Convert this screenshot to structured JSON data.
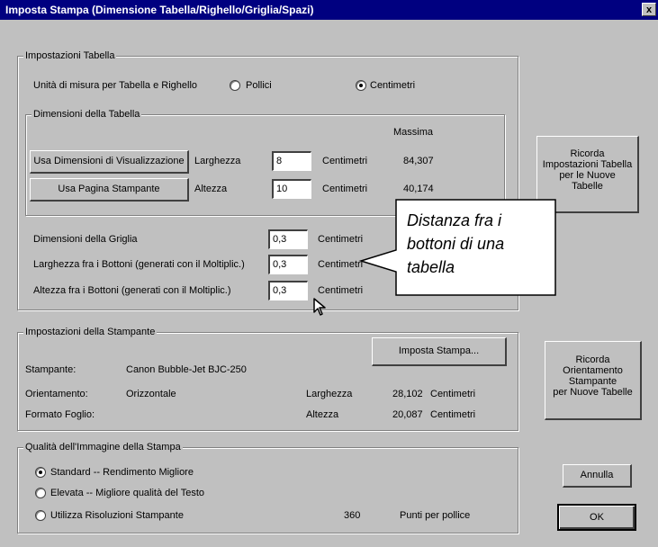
{
  "window": {
    "title": "Imposta Stampa (Dimensione Tabella/Righello/Griglia/Spazi)",
    "close_glyph": "x"
  },
  "table_settings": {
    "group_title": "Impostazioni Tabella",
    "units_label": "Unità di misura per Tabella e Righello",
    "unit_options": [
      {
        "label": "Pollici",
        "selected": false
      },
      {
        "label": "Centimetri",
        "selected": true
      }
    ],
    "dimensions": {
      "group_title": "Dimensioni della Tabella",
      "max_header": "Massima",
      "use_view_button": "Usa Dimensioni di Visualizzazione",
      "use_page_button": "Usa Pagina Stampante",
      "width_label": "Larghezza",
      "width_value": "8",
      "width_unit": "Centimetri",
      "width_max": "84,307",
      "height_label": "Altezza",
      "height_value": "10",
      "height_unit": "Centimetri",
      "height_max": "40,174"
    },
    "grid_label": "Dimensioni della Griglia",
    "grid_value": "0,3",
    "grid_unit": "Centimetri",
    "btn_width_label": "Larghezza fra i Bottoni (generati con il Moltiplic.)",
    "btn_width_value": "0,3",
    "btn_width_unit": "Centimetri",
    "btn_height_label": "Altezza fra i Bottoni (generati con il Moltiplic.)",
    "btn_height_value": "0,3",
    "btn_height_unit": "Centimetri"
  },
  "remember_table_button": [
    "Ricorda",
    "Impostazioni Tabella",
    "per le Nuove",
    "Tabelle"
  ],
  "callout": {
    "lines": [
      "Distanza fra i",
      "bottoni di una",
      "tabella"
    ]
  },
  "printer_settings": {
    "group_title": "Impostazioni della Stampante",
    "setup_button": "Imposta Stampa...",
    "printer_label": "Stampante:",
    "printer_value": "Canon Bubble-Jet BJC-250",
    "orientation_label": "Orientamento:",
    "orientation_value": "Orizzontale",
    "paper_label": "Formato Foglio:",
    "width_label": "Larghezza",
    "width_value": "28,102",
    "width_unit": "Centimetri",
    "height_label": "Altezza",
    "height_value": "20,087",
    "height_unit": "Centimetri"
  },
  "remember_orientation_button": [
    "Ricorda",
    "Orientamento",
    "Stampante",
    "per Nuove Tabelle"
  ],
  "print_quality": {
    "group_title": "Qualità dell'Immagine della Stampa",
    "options": [
      {
        "label": "Standard  -- Rendimento Migliore",
        "selected": true
      },
      {
        "label": "Elevata  --  Migliore qualità del Testo",
        "selected": false
      },
      {
        "label": "Utilizza Risoluzioni Stampante",
        "selected": false
      }
    ],
    "dpi_value": "360",
    "dpi_unit": "Punti per pollice"
  },
  "cancel_button": "Annulla",
  "ok_button": "OK"
}
